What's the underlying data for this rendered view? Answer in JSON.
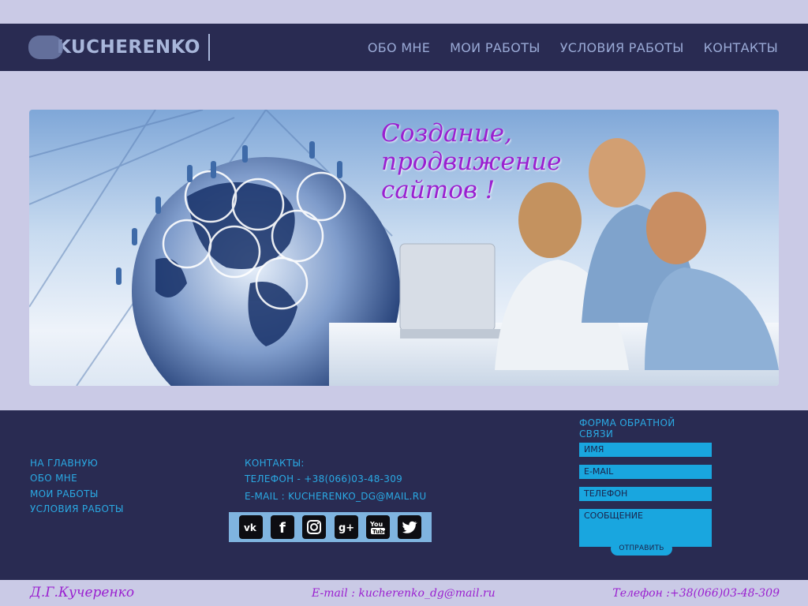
{
  "header": {
    "logo_text": "KUCHERENKO",
    "nav": [
      "ОБО МНЕ",
      "МОИ РАБОТЫ",
      "УСЛОВИЯ РАБОТЫ",
      "КОНТАКТЫ"
    ]
  },
  "banner": {
    "slogan_lines": [
      "Создание,",
      "продвижение",
      "сайтов !"
    ]
  },
  "footer": {
    "links": [
      "НА ГЛАВНУЮ",
      "ОБО МНЕ",
      "МОИ РАБОТЫ",
      "УСЛОВИЯ РАБОТЫ"
    ],
    "contacts": {
      "title": "КОНТАКТЫ:",
      "phone": "ТЕЛЕФОН - +38(066)03-48-309",
      "email": "E-MAIL : KUCHERENKO_DG@MAIL.RU"
    },
    "social": [
      "vk-icon",
      "facebook-icon",
      "instagram-icon",
      "google-plus-icon",
      "youtube-icon",
      "twitter-icon"
    ],
    "form": {
      "title": "ФОРМА ОБРАТНОЙ СВЯЗИ",
      "name_placeholder": "ИМЯ",
      "email_placeholder": "E-MAIL",
      "phone_placeholder": "ТЕЛЕФОН",
      "message_placeholder": "СООБЩЕНИЕ",
      "submit": "ОТПРАВИТЬ"
    }
  },
  "bottom": {
    "name": "Д.Г.Кучеренко",
    "email": "E-mail : kucherenko_dg@mail.ru",
    "phone": "Телефон :+38(066)03-48-309"
  },
  "colors": {
    "page_bg": "#cacae6",
    "bar_bg": "#292b52",
    "accent_blue": "#2aa9e3",
    "accent_purple": "#9a1fd0"
  }
}
